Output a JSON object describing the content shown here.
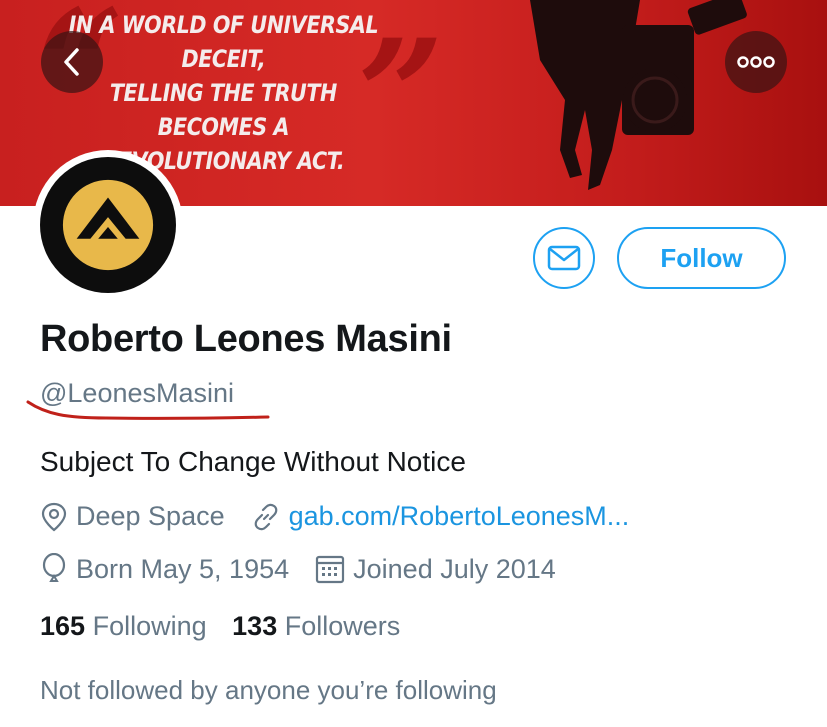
{
  "banner": {
    "quote_lines": [
      "IN A WORLD OF UNIVERSAL DECEIT,",
      "TELLING THE TRUTH BECOMES A",
      "REVOLUTIONARY ACT."
    ],
    "background_color": "#d62a26"
  },
  "nav": {
    "back_icon": "chevron-left-icon",
    "more_icon": "more-horizontal-icon"
  },
  "profile": {
    "avatar_icon": "lambda-logo-icon",
    "avatar_logo_color": "#e8b84a",
    "display_name": "Roberto Leones Masini",
    "handle": "@LeonesMasini",
    "bio": "Subject To Change Without Notice",
    "location": "Deep Space",
    "website": "gab.com/RobertoLeonesM...",
    "birthday": "Born May 5, 1954",
    "joined": "Joined July 2014"
  },
  "actions": {
    "message_icon": "envelope-icon",
    "follow_label": "Follow",
    "accent_color": "#1da1f2"
  },
  "stats": {
    "following_count": "165",
    "following_label": "Following",
    "followers_count": "133",
    "followers_label": "Followers"
  },
  "social_context": "Not followed by anyone you’re following",
  "annotation": {
    "underline_color": "#c0211a"
  }
}
